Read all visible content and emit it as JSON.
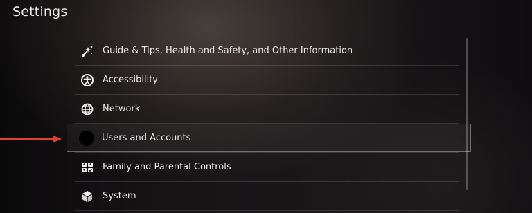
{
  "page": {
    "title": "Settings"
  },
  "menu": {
    "items": [
      {
        "label": "Guide & Tips, Health and Safety, and Other Information",
        "icon": "guide-icon"
      },
      {
        "label": "Accessibility",
        "icon": "accessibility-icon"
      },
      {
        "label": "Network",
        "icon": "globe-icon"
      },
      {
        "label": "Users and Accounts",
        "icon": "user-avatar",
        "selected": true
      },
      {
        "label": "Family and Parental Controls",
        "icon": "family-icon"
      },
      {
        "label": "System",
        "icon": "cube-icon"
      }
    ]
  },
  "colors": {
    "arrow": "#e0432b",
    "text": "#ebebeb"
  }
}
